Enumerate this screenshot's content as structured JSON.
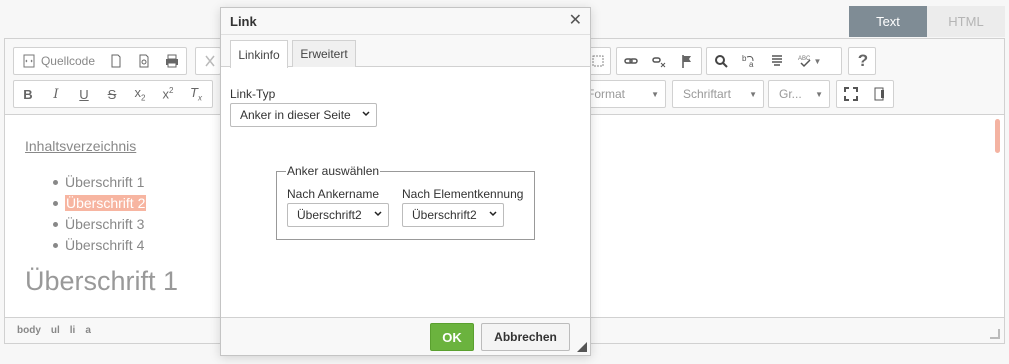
{
  "mode_tabs": {
    "text": "Text",
    "html": "HTML"
  },
  "toolbar": {
    "source_label": "Quellcode",
    "format_label": "Format",
    "font_label": "Schriftart",
    "size_label": "Gr..."
  },
  "content": {
    "toc_link": "Inhaltsverzeichnis",
    "toc_items": [
      "Überschrift 1",
      "Überschrift 2",
      "Überschrift 3",
      "Überschrift 4"
    ],
    "heading": "Überschrift 1"
  },
  "statusbar": {
    "path": [
      "body",
      "ul",
      "li",
      "a"
    ]
  },
  "dialog": {
    "title": "Link",
    "tabs": [
      "Linkinfo",
      "Erweitert"
    ],
    "link_type_label": "Link-Typ",
    "link_type_value": "Anker in dieser Seite",
    "fieldset_legend": "Anker auswählen",
    "by_anchor_name_label": "Nach Ankername",
    "by_anchor_name_value": "Überschrift2",
    "by_element_id_label": "Nach Elementkennung",
    "by_element_id_value": "Überschrift2",
    "ok_label": "OK",
    "cancel_label": "Abbrechen"
  },
  "colors": {
    "ok_green": "#6bb33e",
    "mode_active": "#7f8c95",
    "selection": "#f7b5a1"
  }
}
